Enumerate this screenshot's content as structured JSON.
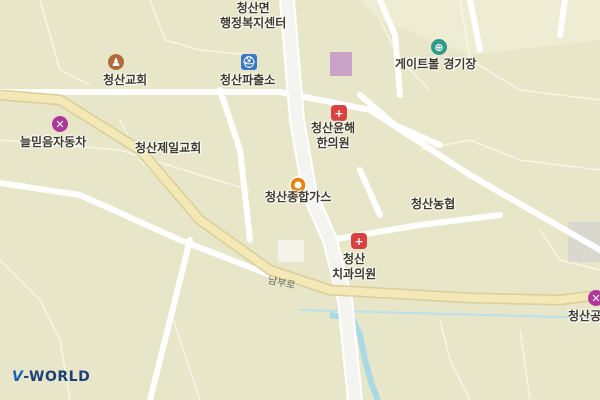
{
  "map": {
    "background": "#e7e6c9",
    "road_color": "#ffffff",
    "highway_color": "#f3e8b6",
    "water_color": "#a9d9e6"
  },
  "labels": {
    "admin_center": "청산면\n행정복지센터",
    "church1": "청산교회",
    "police": "청산파출소",
    "gateball": "게이트볼 경기장",
    "hospital1": "청산윤해\n한의원",
    "carshop": "늘믿음자동차",
    "church2": "청산제일교회",
    "gas": "청산종합가스",
    "nonghyup": "청산농협",
    "dental": "청산\n치과의원",
    "road": "남부로",
    "edge_right": "청산공"
  },
  "icons": {
    "church1": "church-icon",
    "police": "police-icon",
    "gateball": "sports-icon",
    "hospital1": "hospital-icon",
    "carshop": "car-repair-icon",
    "dental": "hospital-icon",
    "edge_right": "car-repair-icon",
    "pin": "location-pin-icon"
  },
  "logo": "V-WORLD"
}
